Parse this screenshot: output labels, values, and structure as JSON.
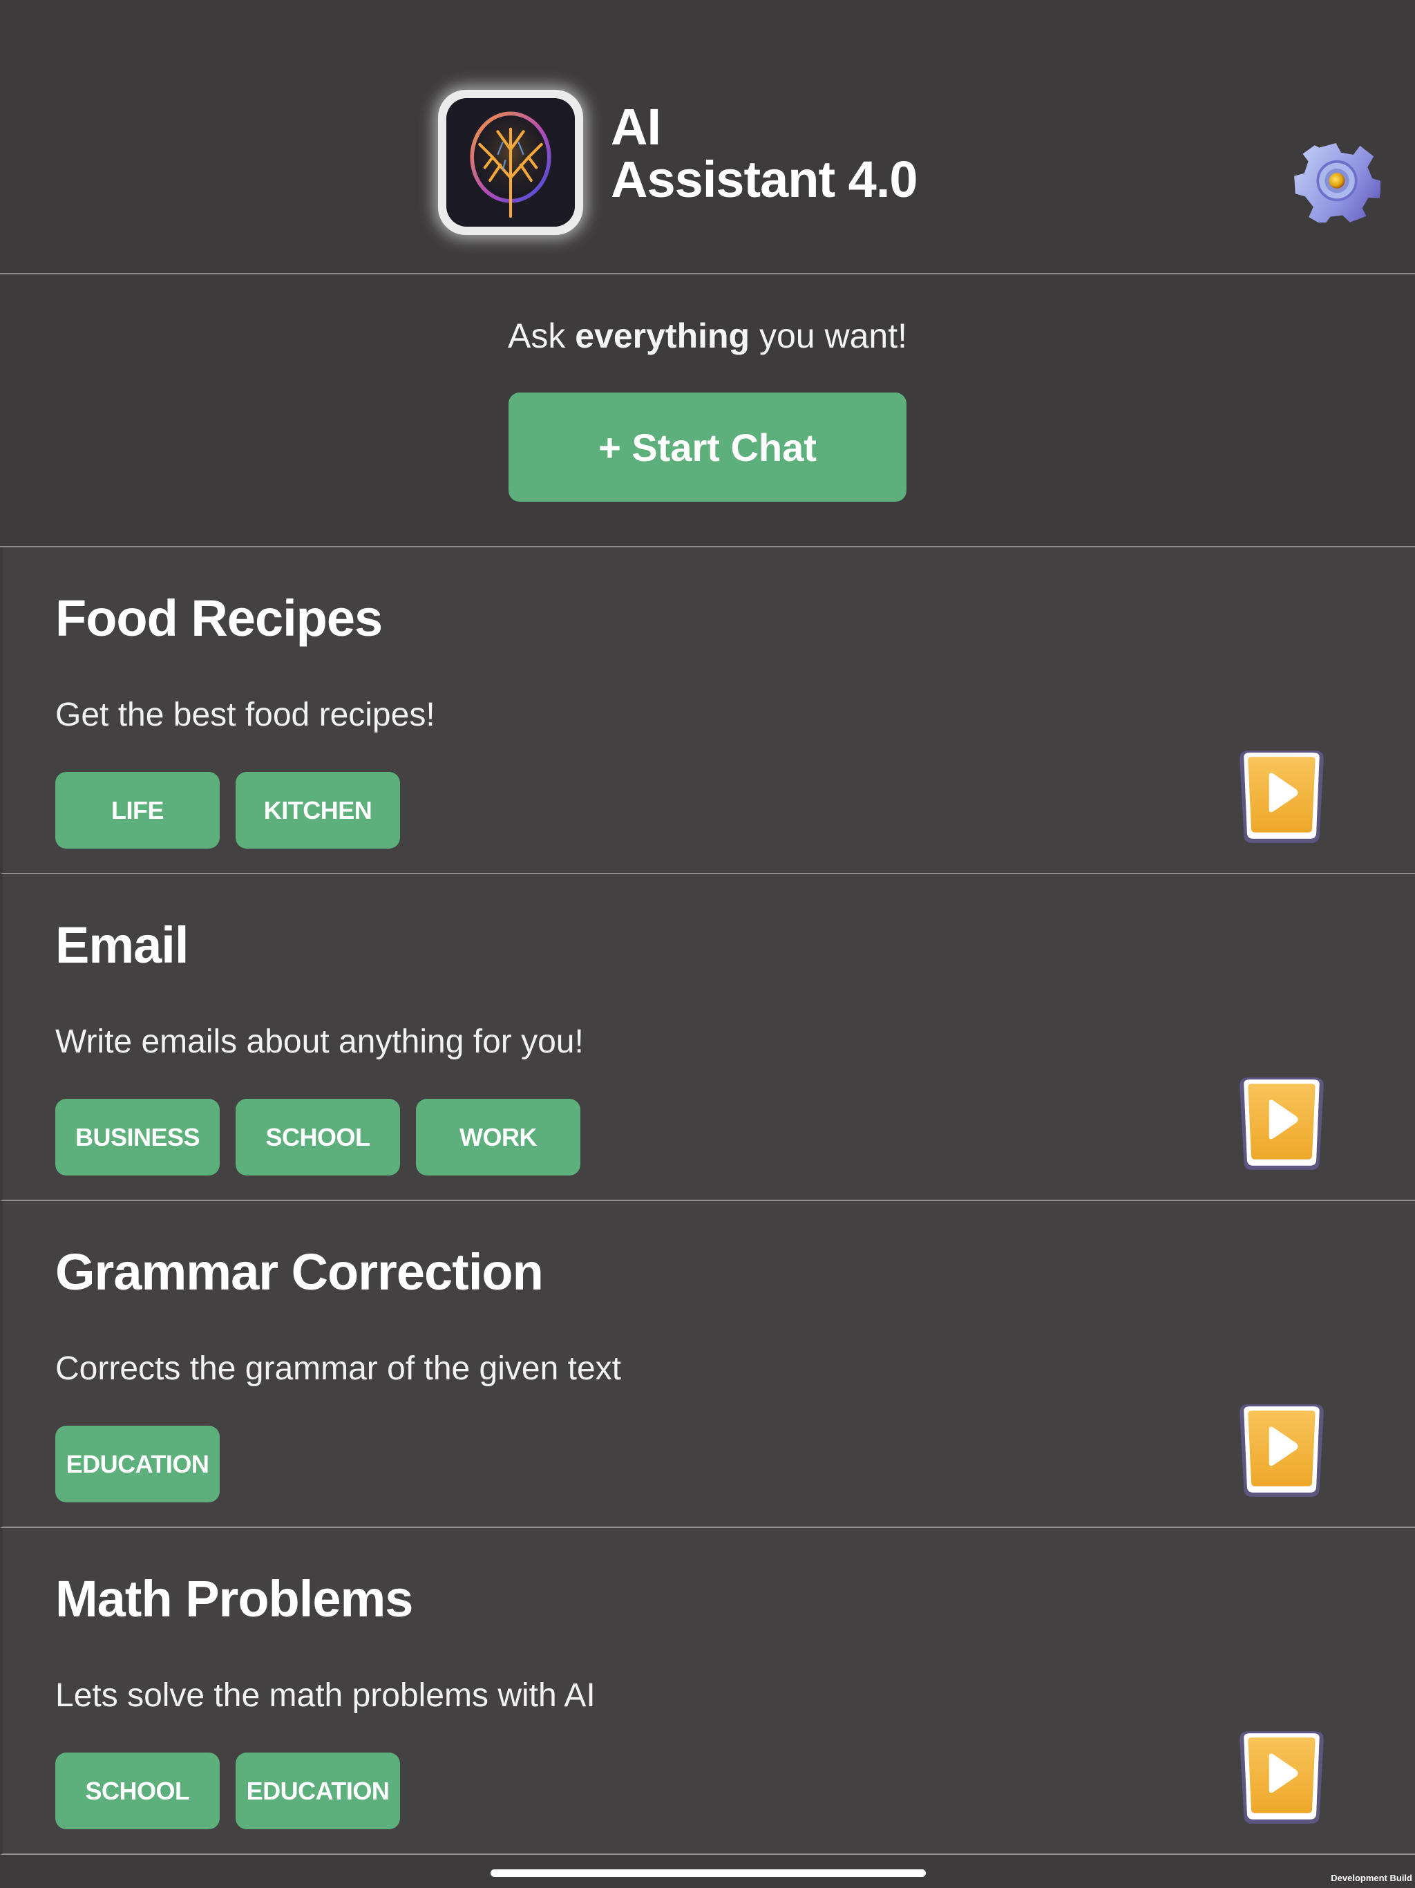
{
  "header": {
    "title_line1": "AI",
    "title_line2": "Assistant 4.0",
    "logo_icon": "brain-tree-icon",
    "settings_icon": "gear-icon"
  },
  "prompt": {
    "tagline_pre": "Ask ",
    "tagline_em": "everything",
    "tagline_post": " you want!",
    "start_chat_label": "+ Start Chat"
  },
  "colors": {
    "background": "#3d3b3c",
    "card_background": "#434142",
    "accent_green": "#5daf7b",
    "play_button": "#f6b53a"
  },
  "cards": [
    {
      "title": "Food Recipes",
      "description": "Get the best food recipes!",
      "tags": [
        "LIFE",
        "KITCHEN"
      ],
      "action_icon": "play-icon"
    },
    {
      "title": "Email",
      "description": "Write emails about anything for you!",
      "tags": [
        "BUSINESS",
        "SCHOOL",
        "WORK"
      ],
      "action_icon": "play-icon"
    },
    {
      "title": "Grammar Correction",
      "description": "Corrects the grammar of the given text",
      "tags": [
        "EDUCATION"
      ],
      "action_icon": "play-icon"
    },
    {
      "title": "Math Problems",
      "description": "Lets solve the math problems with AI",
      "tags": [
        "SCHOOL",
        "EDUCATION"
      ],
      "action_icon": "play-icon"
    }
  ],
  "footer": {
    "build_label": "Development Build"
  }
}
